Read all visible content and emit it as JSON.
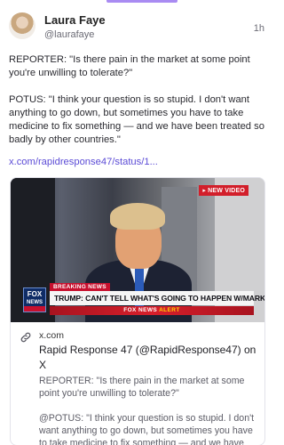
{
  "post": {
    "author_name": "Laura Faye",
    "author_handle": "@laurafaye",
    "timestamp": "1h",
    "body_paragraphs": [
      "REPORTER: \"Is there pain in the market at some point you're unwilling to tolerate?\"",
      "POTUS: \"I think your question is so stupid. I don't want anything to go down, but sometimes you have to take medicine to fix something — and we have been treated so badly by other countries.\""
    ],
    "link_text": "x.com/rapidresponse47/status/1..."
  },
  "media": {
    "badge": "NEW VIDEO",
    "network_logo_top": "FOX",
    "network_logo_bottom": "NEWS",
    "network_stamp": "channel",
    "breaking_tag": "BREAKING NEWS",
    "headline": "TRUMP: CAN'T TELL WHAT'S GOING TO HAPPEN W/MARKETS",
    "alert_prefix": "FOX NEWS",
    "alert_word": "ALERT"
  },
  "link_preview": {
    "domain": "x.com",
    "title": "Rapid Response 47 (@RapidResponse47) on X",
    "description_paragraphs": [
      "REPORTER: \"Is there pain in the market at some point you're unwilling to tolerate?\"",
      "@POTUS: \"I think your question is so stupid. I don't want anything to go down, but sometimes you have to take medicine to fix something — and we have been treated so badly by other countries.\""
    ]
  },
  "colors": {
    "accent": "#a98bf2",
    "link": "#5b4bd6",
    "breaking_red": "#c8102e"
  },
  "icons": {
    "link": "link-icon",
    "play": "play-arrow-icon"
  }
}
